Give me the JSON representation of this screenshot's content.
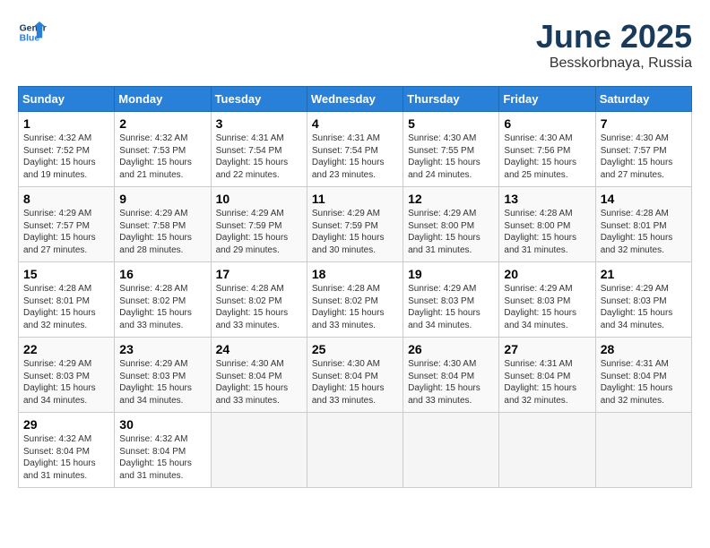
{
  "header": {
    "logo_line1": "General",
    "logo_line2": "Blue",
    "month": "June 2025",
    "location": "Besskorbnaya, Russia"
  },
  "weekdays": [
    "Sunday",
    "Monday",
    "Tuesday",
    "Wednesday",
    "Thursday",
    "Friday",
    "Saturday"
  ],
  "weeks": [
    [
      {
        "day": "1",
        "info": "Sunrise: 4:32 AM\nSunset: 7:52 PM\nDaylight: 15 hours\nand 19 minutes."
      },
      {
        "day": "2",
        "info": "Sunrise: 4:32 AM\nSunset: 7:53 PM\nDaylight: 15 hours\nand 21 minutes."
      },
      {
        "day": "3",
        "info": "Sunrise: 4:31 AM\nSunset: 7:54 PM\nDaylight: 15 hours\nand 22 minutes."
      },
      {
        "day": "4",
        "info": "Sunrise: 4:31 AM\nSunset: 7:54 PM\nDaylight: 15 hours\nand 23 minutes."
      },
      {
        "day": "5",
        "info": "Sunrise: 4:30 AM\nSunset: 7:55 PM\nDaylight: 15 hours\nand 24 minutes."
      },
      {
        "day": "6",
        "info": "Sunrise: 4:30 AM\nSunset: 7:56 PM\nDaylight: 15 hours\nand 25 minutes."
      },
      {
        "day": "7",
        "info": "Sunrise: 4:30 AM\nSunset: 7:57 PM\nDaylight: 15 hours\nand 27 minutes."
      }
    ],
    [
      {
        "day": "8",
        "info": "Sunrise: 4:29 AM\nSunset: 7:57 PM\nDaylight: 15 hours\nand 27 minutes."
      },
      {
        "day": "9",
        "info": "Sunrise: 4:29 AM\nSunset: 7:58 PM\nDaylight: 15 hours\nand 28 minutes."
      },
      {
        "day": "10",
        "info": "Sunrise: 4:29 AM\nSunset: 7:59 PM\nDaylight: 15 hours\nand 29 minutes."
      },
      {
        "day": "11",
        "info": "Sunrise: 4:29 AM\nSunset: 7:59 PM\nDaylight: 15 hours\nand 30 minutes."
      },
      {
        "day": "12",
        "info": "Sunrise: 4:29 AM\nSunset: 8:00 PM\nDaylight: 15 hours\nand 31 minutes."
      },
      {
        "day": "13",
        "info": "Sunrise: 4:28 AM\nSunset: 8:00 PM\nDaylight: 15 hours\nand 31 minutes."
      },
      {
        "day": "14",
        "info": "Sunrise: 4:28 AM\nSunset: 8:01 PM\nDaylight: 15 hours\nand 32 minutes."
      }
    ],
    [
      {
        "day": "15",
        "info": "Sunrise: 4:28 AM\nSunset: 8:01 PM\nDaylight: 15 hours\nand 32 minutes."
      },
      {
        "day": "16",
        "info": "Sunrise: 4:28 AM\nSunset: 8:02 PM\nDaylight: 15 hours\nand 33 minutes."
      },
      {
        "day": "17",
        "info": "Sunrise: 4:28 AM\nSunset: 8:02 PM\nDaylight: 15 hours\nand 33 minutes."
      },
      {
        "day": "18",
        "info": "Sunrise: 4:28 AM\nSunset: 8:02 PM\nDaylight: 15 hours\nand 33 minutes."
      },
      {
        "day": "19",
        "info": "Sunrise: 4:29 AM\nSunset: 8:03 PM\nDaylight: 15 hours\nand 34 minutes."
      },
      {
        "day": "20",
        "info": "Sunrise: 4:29 AM\nSunset: 8:03 PM\nDaylight: 15 hours\nand 34 minutes."
      },
      {
        "day": "21",
        "info": "Sunrise: 4:29 AM\nSunset: 8:03 PM\nDaylight: 15 hours\nand 34 minutes."
      }
    ],
    [
      {
        "day": "22",
        "info": "Sunrise: 4:29 AM\nSunset: 8:03 PM\nDaylight: 15 hours\nand 34 minutes."
      },
      {
        "day": "23",
        "info": "Sunrise: 4:29 AM\nSunset: 8:03 PM\nDaylight: 15 hours\nand 34 minutes."
      },
      {
        "day": "24",
        "info": "Sunrise: 4:30 AM\nSunset: 8:04 PM\nDaylight: 15 hours\nand 33 minutes."
      },
      {
        "day": "25",
        "info": "Sunrise: 4:30 AM\nSunset: 8:04 PM\nDaylight: 15 hours\nand 33 minutes."
      },
      {
        "day": "26",
        "info": "Sunrise: 4:30 AM\nSunset: 8:04 PM\nDaylight: 15 hours\nand 33 minutes."
      },
      {
        "day": "27",
        "info": "Sunrise: 4:31 AM\nSunset: 8:04 PM\nDaylight: 15 hours\nand 32 minutes."
      },
      {
        "day": "28",
        "info": "Sunrise: 4:31 AM\nSunset: 8:04 PM\nDaylight: 15 hours\nand 32 minutes."
      }
    ],
    [
      {
        "day": "29",
        "info": "Sunrise: 4:32 AM\nSunset: 8:04 PM\nDaylight: 15 hours\nand 31 minutes."
      },
      {
        "day": "30",
        "info": "Sunrise: 4:32 AM\nSunset: 8:04 PM\nDaylight: 15 hours\nand 31 minutes."
      },
      {
        "day": "",
        "info": ""
      },
      {
        "day": "",
        "info": ""
      },
      {
        "day": "",
        "info": ""
      },
      {
        "day": "",
        "info": ""
      },
      {
        "day": "",
        "info": ""
      }
    ]
  ]
}
